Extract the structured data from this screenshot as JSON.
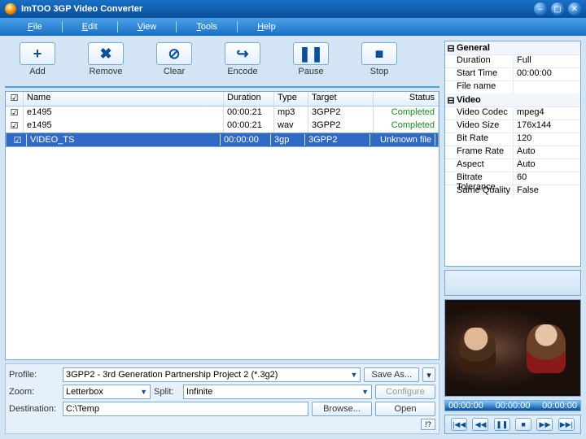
{
  "title": "ImTOO 3GP Video Converter",
  "menu": [
    "File",
    "Edit",
    "View",
    "Tools",
    "Help"
  ],
  "toolbar": [
    {
      "icon": "+",
      "label": "Add"
    },
    {
      "icon": "✖",
      "label": "Remove"
    },
    {
      "icon": "⊘",
      "label": "Clear"
    },
    {
      "icon": "↪",
      "label": "Encode"
    },
    {
      "icon": "❚❚",
      "label": "Pause"
    },
    {
      "icon": "■",
      "label": "Stop"
    }
  ],
  "cols": {
    "name": "Name",
    "duration": "Duration",
    "type": "Type",
    "target": "Target",
    "status": "Status"
  },
  "rows": [
    {
      "chk": true,
      "name": "e1495",
      "duration": "00:00:21",
      "type": "mp3",
      "target": "3GPP2",
      "status": "Completed",
      "sel": false
    },
    {
      "chk": true,
      "name": "e1495",
      "duration": "00:00:21",
      "type": "wav",
      "target": "3GPP2",
      "status": "Completed",
      "sel": false
    },
    {
      "chk": true,
      "name": "VIDEO_TS",
      "duration": "00:00:00",
      "type": "3gp",
      "target": "3GPP2",
      "status": "Unknown file",
      "sel": true
    }
  ],
  "bottom": {
    "profile_lbl": "Profile:",
    "profile": "3GPP2 - 3rd Generation Partnership Project 2  (*.3g2)",
    "saveas": "Save As...",
    "zoom_lbl": "Zoom:",
    "zoom": "Letterbox",
    "split_lbl": "Split:",
    "split": "Infinite",
    "configure": "Configure",
    "dest_lbl": "Destination:",
    "dest": "C:\\Temp",
    "browse": "Browse...",
    "open": "Open",
    "help": "!?"
  },
  "props": {
    "groups": [
      {
        "name": "General",
        "items": [
          {
            "k": "Duration",
            "v": "Full"
          },
          {
            "k": "Start Time",
            "v": "00:00:00"
          },
          {
            "k": "File name",
            "v": ""
          }
        ]
      },
      {
        "name": "Video",
        "items": [
          {
            "k": "Video Codec",
            "v": "mpeg4"
          },
          {
            "k": "Video Size",
            "v": "176x144"
          },
          {
            "k": "Bit Rate",
            "v": "120"
          },
          {
            "k": "Frame Rate",
            "v": "Auto"
          },
          {
            "k": "Aspect",
            "v": "Auto"
          },
          {
            "k": "Bitrate Tolerance",
            "v": "60"
          },
          {
            "k": "Same Quality",
            "v": "False"
          }
        ]
      }
    ]
  },
  "player": {
    "t1": "00:00:00",
    "t2": "00:00:00",
    "t3": "00:00:00"
  }
}
